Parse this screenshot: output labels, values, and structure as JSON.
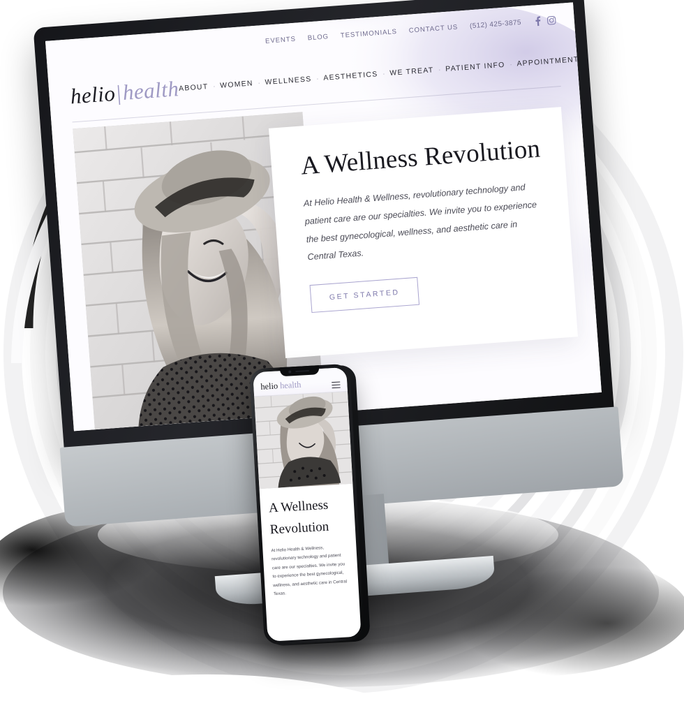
{
  "brand": {
    "logo_primary": "helio",
    "logo_separator": "|",
    "logo_secondary": "health",
    "accent_color": "#9f9ac4",
    "cta_border_color": "#a9a4cf",
    "text_color": "#191920"
  },
  "desktop": {
    "topbar": {
      "links": [
        {
          "label": "EVENTS"
        },
        {
          "label": "BLOG"
        },
        {
          "label": "TESTIMONIALS"
        },
        {
          "label": "CONTACT US"
        }
      ],
      "phone": "(512) 425-3875",
      "social": [
        {
          "name": "facebook-icon",
          "glyph": "f"
        },
        {
          "name": "instagram-icon",
          "glyph": "instagram"
        }
      ]
    },
    "nav": {
      "items": [
        {
          "label": "ABOUT"
        },
        {
          "label": "WOMEN"
        },
        {
          "label": "WELLNESS"
        },
        {
          "label": "AESTHETICS"
        },
        {
          "label": "WE TREAT"
        },
        {
          "label": "PATIENT INFO"
        },
        {
          "label": "APPOINTMENTS"
        }
      ],
      "separator": "·"
    },
    "hero": {
      "image_alt": "smiling-woman-straw-hat-brick-wall",
      "heading": "A Wellness Revolution",
      "body": "At Helio Health & Wellness, revolutionary technology and patient care are our specialties. We invite you to experience the best gynecological, wellness, and aesthetic care in Central Texas.",
      "cta_label": "GET STARTED"
    }
  },
  "mobile": {
    "logo_primary": "helio",
    "logo_secondary": "health",
    "menu_icon": "hamburger-menu-icon",
    "hero": {
      "heading_line1": "A Wellness",
      "heading_line2": "Revolution",
      "body": "At Helio Health & Wellness, revolutionary technology and patient care are our specialties. We invite you to experience the best gynecological, wellness, and aesthetic care in Central Texas."
    }
  },
  "scene": {
    "desktop_device": "imac-desktop-mockup",
    "mobile_device": "iphone-mockup",
    "background": "concentric-rings-and-ink-shadow"
  }
}
